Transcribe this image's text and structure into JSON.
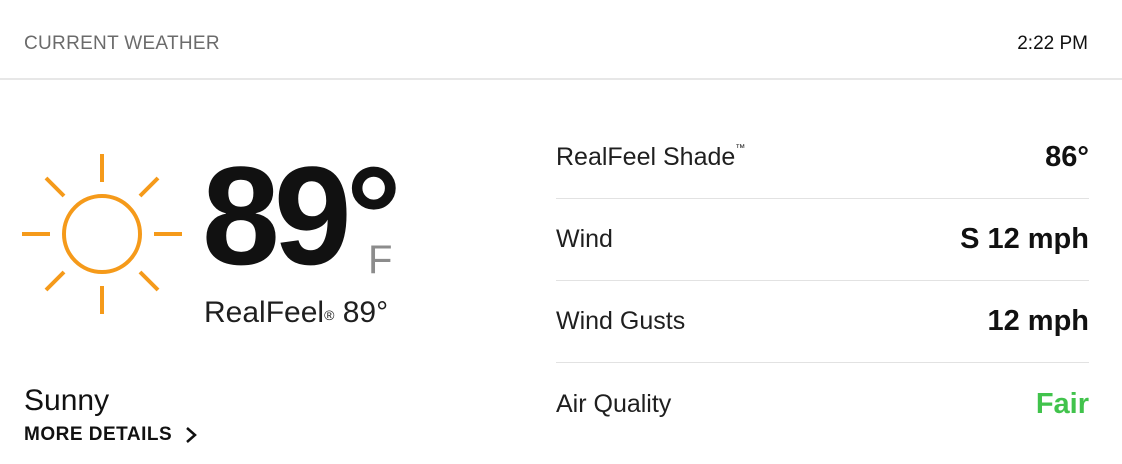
{
  "header": {
    "title": "CURRENT WEATHER",
    "time": "2:22 PM"
  },
  "current": {
    "icon": "sun-icon",
    "icon_color": "#f59a1a",
    "temperature": "89°",
    "unit": "F",
    "realfeel_label": "RealFeel",
    "realfeel_mark": "®",
    "realfeel_value": "89°",
    "condition": "Sunny",
    "more_details": "MORE DETAILS"
  },
  "details": [
    {
      "label": "RealFeel Shade",
      "mark": "™",
      "value": "86°"
    },
    {
      "label": "Wind",
      "mark": "",
      "value": "S 12 mph"
    },
    {
      "label": "Wind Gusts",
      "mark": "",
      "value": "12 mph"
    },
    {
      "label": "Air Quality",
      "mark": "",
      "value": "Fair",
      "value_color": "#41c34c"
    }
  ]
}
